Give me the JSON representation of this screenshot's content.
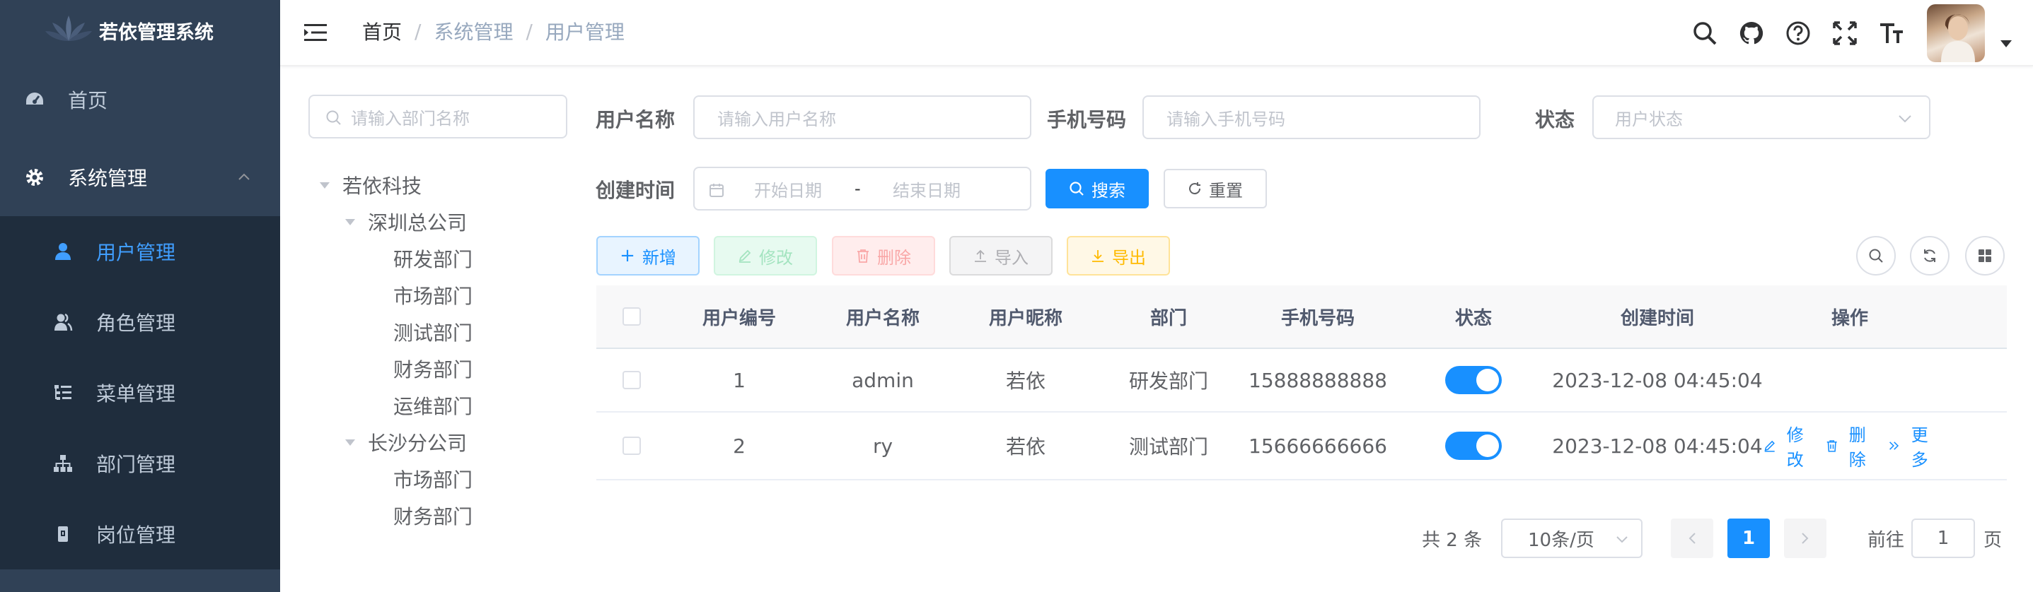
{
  "app": {
    "title": "若依管理系统"
  },
  "sidebar": {
    "items": [
      {
        "label": "首页",
        "icon": "dashboard-icon"
      },
      {
        "label": "系统管理",
        "icon": "gear-icon",
        "expanded": true
      }
    ],
    "subitems": [
      {
        "label": "用户管理",
        "icon": "user-icon",
        "active": true
      },
      {
        "label": "角色管理",
        "icon": "peoples-icon"
      },
      {
        "label": "菜单管理",
        "icon": "tree-table-icon"
      },
      {
        "label": "部门管理",
        "icon": "tree-icon"
      },
      {
        "label": "岗位管理",
        "icon": "post-icon"
      }
    ]
  },
  "breadcrumb": {
    "home": "首页",
    "level1": "系统管理",
    "level2": "用户管理",
    "separator": "/"
  },
  "navbar_icons": [
    "search-icon",
    "github-icon",
    "question-icon",
    "fullscreen-icon",
    "font-size-icon"
  ],
  "dept": {
    "search_placeholder": "请输入部门名称",
    "tree": {
      "root": "若依科技",
      "branch1": "深圳总公司",
      "branch1_children": [
        "研发部门",
        "市场部门",
        "测试部门",
        "财务部门",
        "运维部门"
      ],
      "branch2": "长沙分公司",
      "branch2_children": [
        "市场部门",
        "财务部门"
      ]
    }
  },
  "filters": {
    "username_label": "用户名称",
    "username_placeholder": "请输入用户名称",
    "phone_label": "手机号码",
    "phone_placeholder": "请输入手机号码",
    "status_label": "状态",
    "status_placeholder": "用户状态",
    "created_label": "创建时间",
    "start_placeholder": "开始日期",
    "range_separator": "-",
    "end_placeholder": "结束日期",
    "search_button": "搜索",
    "reset_button": "重置"
  },
  "toolbar": {
    "add": "新增",
    "edit": "修改",
    "delete": "删除",
    "import": "导入",
    "export": "导出"
  },
  "table": {
    "headers": [
      "用户编号",
      "用户名称",
      "用户昵称",
      "部门",
      "手机号码",
      "状态",
      "创建时间",
      "操作"
    ],
    "rows": [
      {
        "id": "1",
        "username": "admin",
        "nickname": "若依",
        "dept": "研发部门",
        "phone": "15888888888",
        "status": true,
        "created": "2023-12-08 04:45:04",
        "actions": []
      },
      {
        "id": "2",
        "username": "ry",
        "nickname": "若依",
        "dept": "测试部门",
        "phone": "15666666666",
        "status": true,
        "created": "2023-12-08 04:45:04",
        "actions": [
          "修改",
          "删除",
          "更多"
        ]
      }
    ]
  },
  "pagination": {
    "total": "共 2 条",
    "page_size": "10条/页",
    "current": "1",
    "goto_label": "前往",
    "goto_value": "1",
    "page_suffix": "页"
  },
  "colors": {
    "sidebar_bg": "#304156",
    "submenu_bg": "#1f2d3d",
    "primary": "#1890ff",
    "active_text": "#409eff"
  }
}
